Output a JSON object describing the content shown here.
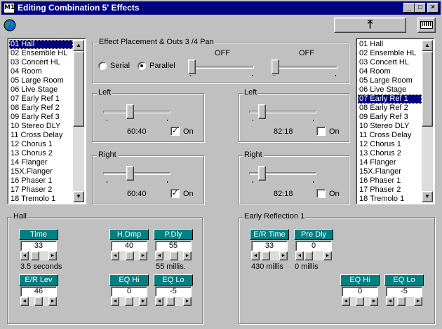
{
  "window": {
    "icon_text": "M1",
    "title": "Editing Combination 5' Effects"
  },
  "toolbar": {
    "upload_symbol": "⤒"
  },
  "effects_left": {
    "items": [
      "01 Hall",
      "02 Ensemble HL",
      "03 Concert HL",
      "04 Room",
      "05 Large Room",
      "06 Live Stage",
      "07 Early Ref 1",
      "08 Early Ref 2",
      "09 Early Ref 3",
      "10 Stereo DLY",
      "11 Cross Delay",
      "12 Chorus 1",
      "13 Chorus 2",
      "14 Flanger",
      "15X.Flanger",
      "16 Phaser 1",
      "17 Phaser 2",
      "18 Tremolo 1"
    ],
    "selected_index": 0
  },
  "effects_right": {
    "items": [
      "01 Hall",
      "02 Ensemble HL",
      "03 Concert HL",
      "04 Room",
      "05 Large Room",
      "06 Live Stage",
      "07 Early Ref 1",
      "08 Early Ref 2",
      "09 Early Ref 3",
      "10 Stereo DLY",
      "11 Cross Delay",
      "12 Chorus 1",
      "13 Chorus 2",
      "14 Flanger",
      "15X.Flanger",
      "16 Phaser 1",
      "17 Phaser 2",
      "18 Tremolo 1"
    ],
    "selected_index": 6
  },
  "placement": {
    "label": "Effect Placement & Outs 3 /4 Pan",
    "serial_label": "Serial",
    "parallel_label": "Parallel",
    "mode": "parallel",
    "pan1_value": "OFF",
    "pan2_value": "OFF"
  },
  "fx1_left": {
    "label": "Left",
    "value": "60:40",
    "on_label": "On",
    "on": true
  },
  "fx1_right": {
    "label": "Right",
    "value": "60:40",
    "on_label": "On",
    "on": true
  },
  "fx2_left": {
    "label": "Left",
    "value": "82:18",
    "on_label": "On",
    "on": false
  },
  "fx2_right": {
    "label": "Right",
    "value": "82:18",
    "on_label": "On",
    "on": false
  },
  "hall": {
    "label": "Hall",
    "time": {
      "label": "Time",
      "value": "33",
      "caption": "3.5 seconds"
    },
    "h_dmp": {
      "label": "H.Dmp",
      "value": "40"
    },
    "p_dly": {
      "label": "P.Dly",
      "value": "55",
      "caption": "55 millis."
    },
    "er_lev": {
      "label": "E/R Lev",
      "value": "46"
    },
    "eq_hi": {
      "label": "EQ Hi",
      "value": "0"
    },
    "eq_lo": {
      "label": "EQ Lo",
      "value": "-5"
    }
  },
  "early_ref": {
    "label": "Early Reflection 1",
    "er_time": {
      "label": "E/R Time",
      "value": "33",
      "caption": "430 millis"
    },
    "pre_dly": {
      "label": "Pre Dly",
      "value": "0",
      "caption": "0 millis"
    },
    "eq_hi": {
      "label": "EQ Hi",
      "value": "0"
    },
    "eq_lo": {
      "label": "EQ Lo",
      "value": "-5"
    }
  }
}
